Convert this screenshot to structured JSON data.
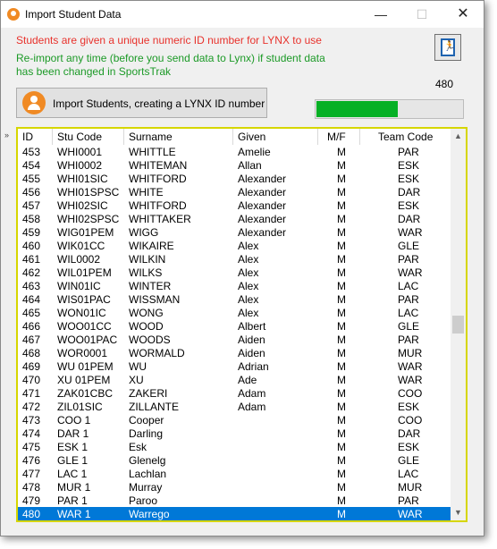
{
  "window": {
    "title": "Import Student Data",
    "minimize": "—",
    "maximize": "☐",
    "close": "✕"
  },
  "messages": {
    "line1": "Students are given a unique numeric ID number for LYNX to use",
    "line2": "Re-import any time (before you send data to Lynx) if student data has been changed in SportsTrak",
    "line1_color": "#e8322c",
    "line2_color": "#1c9a27"
  },
  "exit_button": {
    "icon": "exit-door-icon",
    "glyph": "🏃"
  },
  "count": "480",
  "import_button": {
    "label": "Import Students, creating a LYNX ID number",
    "icon": "user-import-icon"
  },
  "progress": {
    "fraction": 0.56,
    "color": "#06b025"
  },
  "row_marker": "»",
  "grid": {
    "columns": [
      "ID",
      "Stu Code",
      "Surname",
      "Given",
      "M/F",
      "Team Code"
    ],
    "rows": [
      [
        "453",
        "WHI0001",
        "WHITTLE",
        "Amelie",
        "M",
        "PAR"
      ],
      [
        "454",
        "WHI0002",
        "WHITEMAN",
        "Allan",
        "M",
        "ESK"
      ],
      [
        "455",
        "WHI01SIC",
        "WHITFORD",
        "Alexander",
        "M",
        "ESK"
      ],
      [
        "456",
        "WHI01SPSC",
        "WHITE",
        "Alexander",
        "M",
        "DAR"
      ],
      [
        "457",
        "WHI02SIC",
        "WHITFORD",
        "Alexander",
        "M",
        "ESK"
      ],
      [
        "458",
        "WHI02SPSC",
        "WHITTAKER",
        "Alexander",
        "M",
        "DAR"
      ],
      [
        "459",
        "WIG01PEM",
        "WIGG",
        "Alexander",
        "M",
        "WAR"
      ],
      [
        "460",
        "WIK01CC",
        "WIKAIRE",
        "Alex",
        "M",
        "GLE"
      ],
      [
        "461",
        "WIL0002",
        "WILKIN",
        "Alex",
        "M",
        "PAR"
      ],
      [
        "462",
        "WIL01PEM",
        "WILKS",
        "Alex",
        "M",
        "WAR"
      ],
      [
        "463",
        "WIN01IC",
        "WINTER",
        "Alex",
        "M",
        "LAC"
      ],
      [
        "464",
        "WIS01PAC",
        "WISSMAN",
        "Alex",
        "M",
        "PAR"
      ],
      [
        "465",
        "WON01IC",
        "WONG",
        "Alex",
        "M",
        "LAC"
      ],
      [
        "466",
        "WOO01CC",
        "WOOD",
        "Albert",
        "M",
        "GLE"
      ],
      [
        "467",
        "WOO01PAC",
        "WOODS",
        "Aiden",
        "M",
        "PAR"
      ],
      [
        "468",
        "WOR0001",
        "WORMALD",
        "Aiden",
        "M",
        "MUR"
      ],
      [
        "469",
        "WU 01PEM",
        "WU",
        "Adrian",
        "M",
        "WAR"
      ],
      [
        "470",
        "XU 01PEM",
        "XU",
        "Ade",
        "M",
        "WAR"
      ],
      [
        "471",
        "ZAK01CBC",
        "ZAKERI",
        "Adam",
        "M",
        "COO"
      ],
      [
        "472",
        "ZIL01SIC",
        "ZILLANTE",
        "Adam",
        "M",
        "ESK"
      ],
      [
        "473",
        "COO 1",
        "Cooper",
        "",
        "M",
        "COO"
      ],
      [
        "474",
        "DAR 1",
        "Darling",
        "",
        "M",
        "DAR"
      ],
      [
        "475",
        "ESK 1",
        "Esk",
        "",
        "M",
        "ESK"
      ],
      [
        "476",
        "GLE 1",
        "Glenelg",
        "",
        "M",
        "GLE"
      ],
      [
        "477",
        "LAC 1",
        "Lachlan",
        "",
        "M",
        "LAC"
      ],
      [
        "478",
        "MUR 1",
        "Murray",
        "",
        "M",
        "MUR"
      ],
      [
        "479",
        "PAR 1",
        "Paroo",
        "",
        "M",
        "PAR"
      ],
      [
        "480",
        "WAR 1",
        "Warrego",
        "",
        "M",
        "WAR"
      ]
    ],
    "selected_index": 27,
    "selection_color": "#0078d7"
  },
  "scrollbar": {
    "up": "▲",
    "down": "▼"
  }
}
